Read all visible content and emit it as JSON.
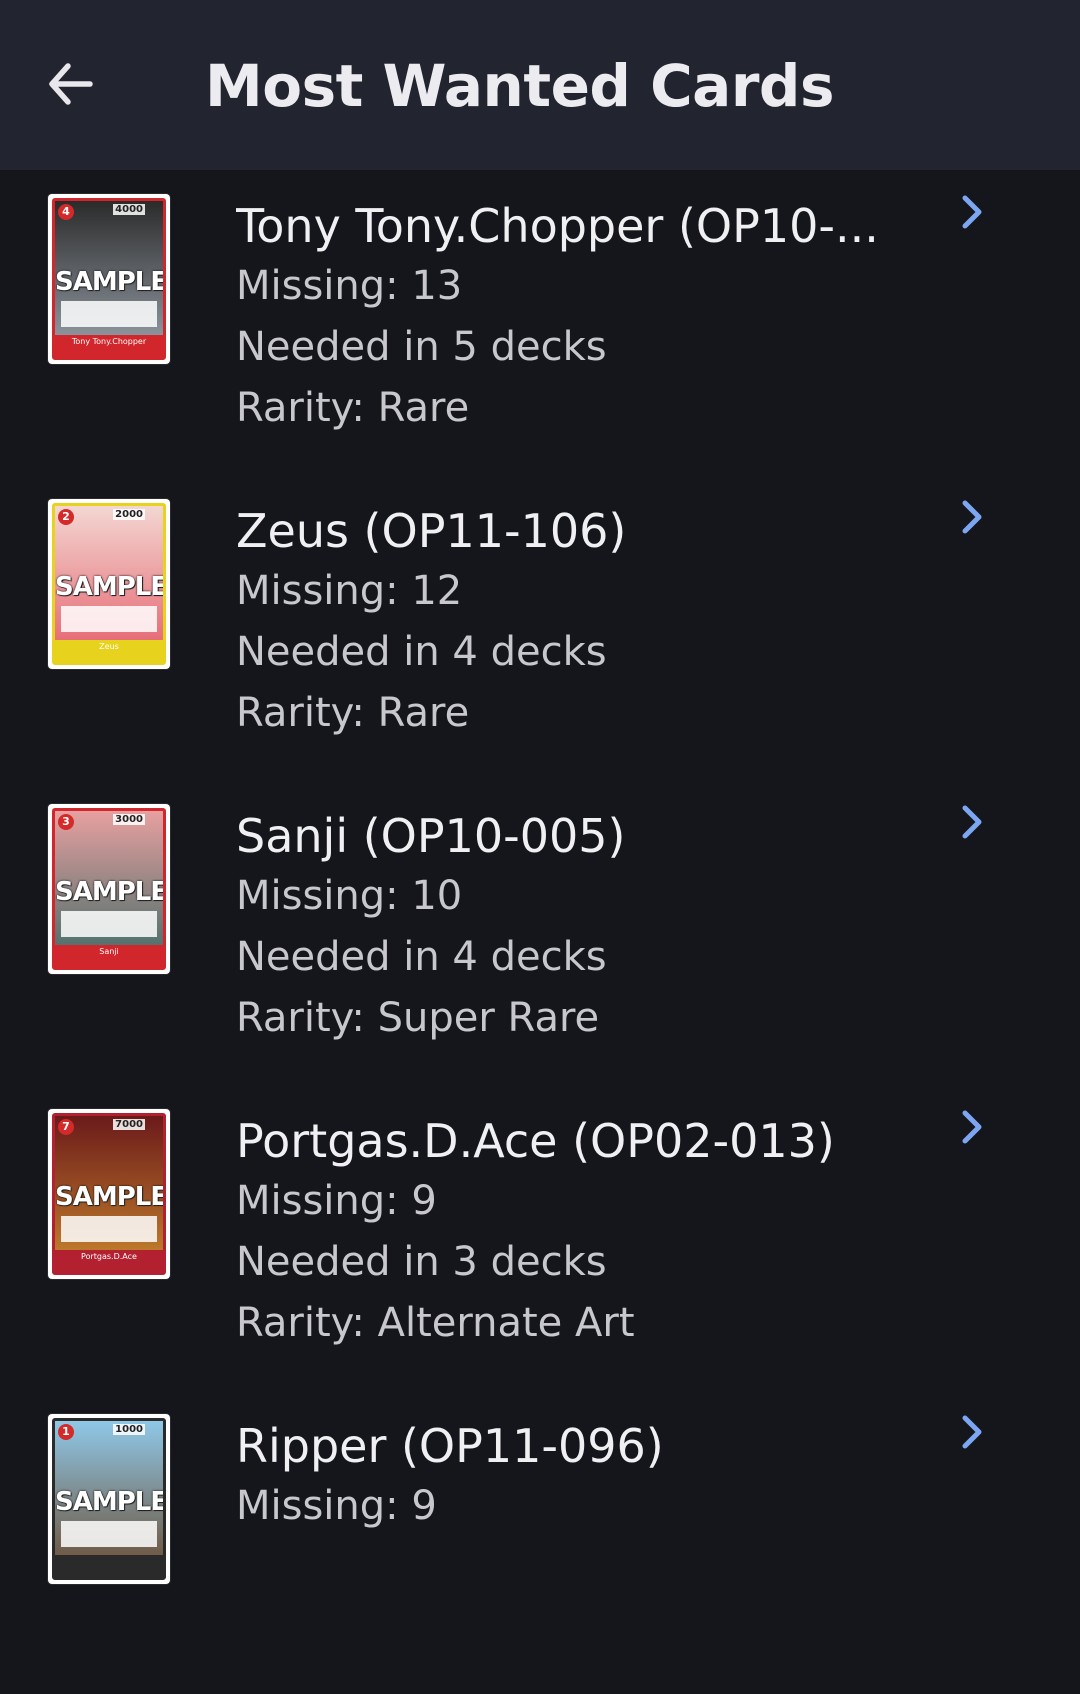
{
  "header": {
    "title": "Most Wanted Cards",
    "back_icon": "arrow-left-icon"
  },
  "colors": {
    "appbar": "#22252f",
    "background": "#15161c",
    "chevron": "#7da6f2"
  },
  "cards": [
    {
      "name": "Tony Tony.Chopper (OP10-...",
      "missing": "Missing: 13",
      "decks": "Needed in 5 decks",
      "rarity": "Rarity: Rare",
      "thumb": {
        "cost": "4",
        "power": "4000",
        "label": "SAMPLE",
        "card_name": "Tony Tony.Chopper",
        "frame_color": "#d1262b",
        "art_top": "#2b2b2b",
        "art_bottom": "#9aa3ad"
      }
    },
    {
      "name": "Zeus (OP11-106)",
      "missing": "Missing: 12",
      "decks": "Needed in 4 decks",
      "rarity": "Rarity: Rare",
      "thumb": {
        "cost": "2",
        "power": "2000",
        "label": "SAMPLE",
        "card_name": "Zeus",
        "frame_color": "#e7d21d",
        "art_top": "#f3d7d2",
        "art_bottom": "#e45d6a"
      }
    },
    {
      "name": "Sanji (OP10-005)",
      "missing": "Missing: 10",
      "decks": "Needed in 4 decks",
      "rarity": "Rarity: Super Rare",
      "thumb": {
        "cost": "3",
        "power": "3000",
        "label": "SAMPLE",
        "card_name": "Sanji",
        "frame_color": "#d1262b",
        "art_top": "#e7a0a0",
        "art_bottom": "#3d6a66"
      }
    },
    {
      "name": "Portgas.D.Ace (OP02-013)",
      "missing": "Missing: 9",
      "decks": "Needed in 3 decks",
      "rarity": "Rarity: Alternate Art",
      "thumb": {
        "cost": "7",
        "power": "7000",
        "label": "SAMPLE",
        "card_name": "Portgas.D.Ace",
        "frame_color": "#b32030",
        "art_top": "#6b1a1a",
        "art_bottom": "#c9872e"
      }
    },
    {
      "name": "Ripper (OP11-096)",
      "missing": "Missing: 9",
      "decks": "",
      "rarity": "",
      "thumb": {
        "cost": "1",
        "power": "1000",
        "label": "SAMPLE",
        "card_name": "",
        "frame_color": "#2a2a2a",
        "art_top": "#8fc8e8",
        "art_bottom": "#6a4a2e"
      }
    }
  ]
}
